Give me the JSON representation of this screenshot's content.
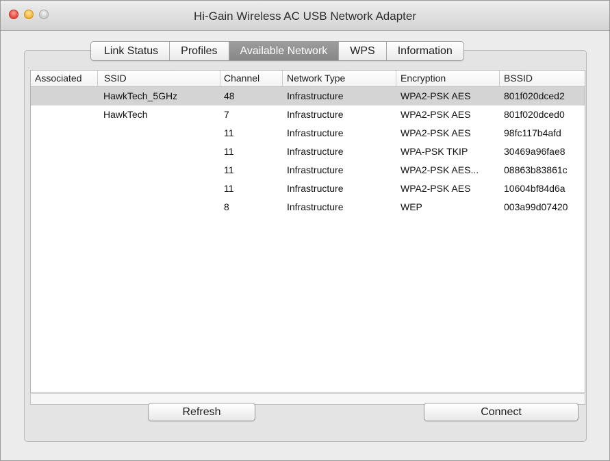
{
  "window": {
    "title": "Hi-Gain Wireless AC USB Network Adapter"
  },
  "tabs": [
    {
      "label": "Link Status",
      "active": false
    },
    {
      "label": "Profiles",
      "active": false
    },
    {
      "label": "Available Network",
      "active": true
    },
    {
      "label": "WPS",
      "active": false
    },
    {
      "label": "Information",
      "active": false
    }
  ],
  "table": {
    "columns": [
      "Associated",
      "SSID",
      "Channel",
      "Network Type",
      "Encryption",
      "BSSID"
    ],
    "rows": [
      {
        "associated": "",
        "ssid": "HawkTech_5GHz",
        "channel": "48",
        "type": "Infrastructure",
        "encryption": "WPA2-PSK AES",
        "bssid": "801f020dced2",
        "selected": true
      },
      {
        "associated": "",
        "ssid": "HawkTech",
        "channel": "7",
        "type": "Infrastructure",
        "encryption": "WPA2-PSK AES",
        "bssid": "801f020dced0",
        "selected": false
      },
      {
        "associated": "",
        "ssid": "",
        "channel": "11",
        "type": "Infrastructure",
        "encryption": "WPA2-PSK AES",
        "bssid": "98fc117b4afd",
        "selected": false
      },
      {
        "associated": "",
        "ssid": "",
        "channel": "11",
        "type": "Infrastructure",
        "encryption": "WPA-PSK TKIP",
        "bssid": "30469a96fae8",
        "selected": false
      },
      {
        "associated": "",
        "ssid": "",
        "channel": "11",
        "type": "Infrastructure",
        "encryption": "WPA2-PSK AES...",
        "bssid": "08863b83861c",
        "selected": false
      },
      {
        "associated": "",
        "ssid": "",
        "channel": "11",
        "type": "Infrastructure",
        "encryption": "WPA2-PSK AES",
        "bssid": "10604bf84d6a",
        "selected": false
      },
      {
        "associated": "",
        "ssid": "",
        "channel": "8",
        "type": "Infrastructure",
        "encryption": "WEP",
        "bssid": "003a99d07420",
        "selected": false
      }
    ]
  },
  "buttons": {
    "refresh": "Refresh",
    "connect": "Connect"
  }
}
